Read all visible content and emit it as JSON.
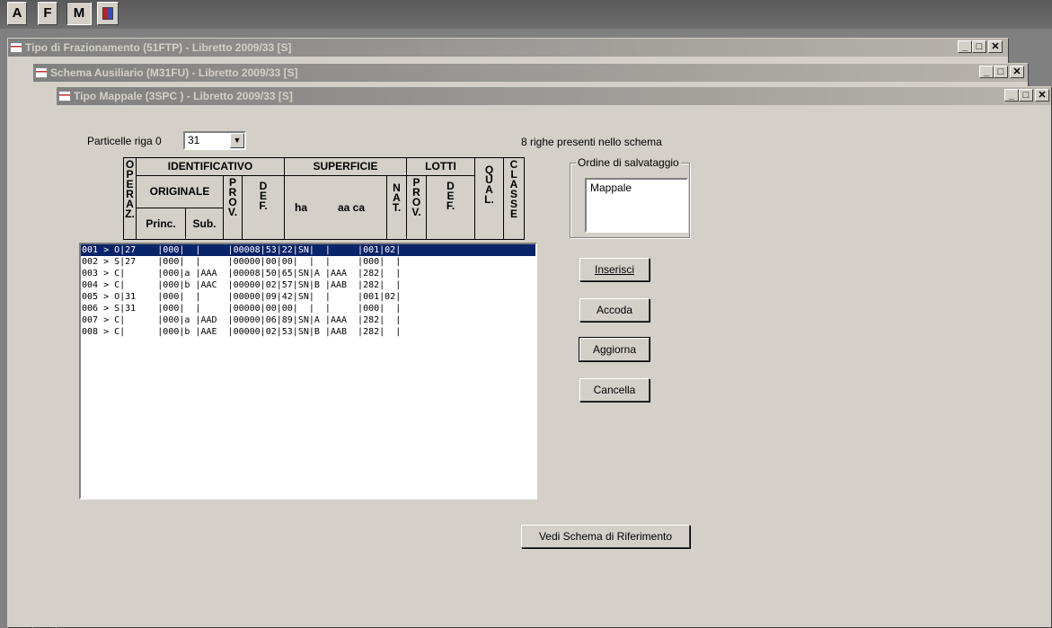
{
  "toolbar": {
    "btn_a": "A",
    "btn_f": "F",
    "btn_m": "M"
  },
  "windows": {
    "w1_title": "Tipo di Frazionamento (51FTP) - Libretto 2009/33 [S]",
    "w2_title": "Schema Ausiliario (M31FU) - Libretto 2009/33 [S]",
    "w3_title": "Tipo Mappale (3SPC ) - Libretto 2009/33 [S]"
  },
  "form": {
    "particelle_label": "Particelle riga 0",
    "particelle_value": "31",
    "righe_info": "8 righe presenti nello schema"
  },
  "headers": {
    "operaz": "O P E R A Z.",
    "identificativo": "IDENTIFICATIVO",
    "originale": "ORIGINALE",
    "prov": "P R O V.",
    "def": "D E F.",
    "princ": "Princ.",
    "sub": "Sub.",
    "superficie": "SUPERFICIE",
    "ha": "ha",
    "aa_ca": "aa ca",
    "nat": "N A T.",
    "lotti": "LOTTI",
    "lprov": "P R O V.",
    "ldef": "D E F.",
    "qual": "Q U A L.",
    "classe": "C L A S S E"
  },
  "rows": [
    "001 > O|27    |000|  |     |00008|53|22|SN|  |     |001|02|",
    "002 > S|27    |000|  |     |00000|00|00|  |  |     |000|  |",
    "003 > C|      |000|a |AAA  |00008|50|65|SN|A |AAA  |282|  |",
    "004 > C|      |000|b |AAC  |00000|02|57|SN|B |AAB  |282|  |",
    "005 > O|31    |000|  |     |00000|09|42|SN|  |     |001|02|",
    "006 > S|31    |000|  |     |00000|00|00|  |  |     |000|  |",
    "007 > C|      |000|a |AAD  |00000|06|89|SN|A |AAA  |282|  |",
    "008 > C|      |000|b |AAE  |00000|02|53|SN|B |AAB  |282|  |"
  ],
  "selected_row": 0,
  "order_group": {
    "label": "Ordine di salvataggio",
    "items": [
      "Mappale"
    ]
  },
  "buttons": {
    "inserisci": "Inserisci",
    "accoda": "Accoda",
    "aggiorna": "Aggiorna",
    "cancella": "Cancella",
    "vedi_schema": "Vedi Schema di Riferimento"
  }
}
